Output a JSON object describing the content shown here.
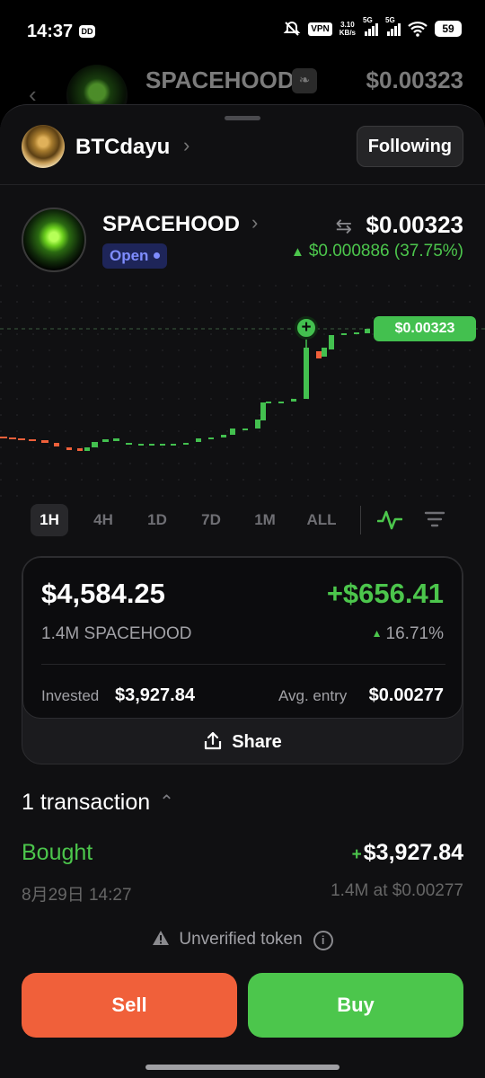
{
  "status_bar": {
    "time": "14:37",
    "app_badge": "DD",
    "vpn": "VPN",
    "speed_value": "3.10",
    "speed_unit": "KB/s",
    "signal1": "5G",
    "signal2": "5G",
    "battery": "59"
  },
  "background_header": {
    "token_name": "SPACEHOOD",
    "price": "$0.00323"
  },
  "creator": {
    "name": "BTCdayu",
    "follow_label": "Following"
  },
  "token": {
    "name": "SPACEHOOD",
    "status": "Open",
    "price": "$0.00323",
    "change": "$0.000886 (37.75%)"
  },
  "chart": {
    "current_price_label": "$0.00323"
  },
  "timeframes": [
    "1H",
    "4H",
    "1D",
    "7D",
    "1M",
    "ALL"
  ],
  "position": {
    "value": "$4,584.25",
    "pnl": "+$656.41",
    "amount": "1.4M SPACEHOOD",
    "pnl_pct": "16.71%",
    "invested_label": "Invested",
    "invested": "$3,927.84",
    "avg_entry_label": "Avg. entry",
    "avg_entry": "$0.00277"
  },
  "share_label": "Share",
  "transactions": {
    "header": "1 transaction",
    "items": [
      {
        "type": "Bought",
        "amount": "$3,927.84",
        "date": "8月29日 14:27",
        "detail": "1.4M at $0.00277"
      }
    ]
  },
  "unverified_label": "Unverified token",
  "actions": {
    "sell": "Sell",
    "buy": "Buy"
  },
  "colors": {
    "green": "#4cc64c",
    "red": "#f0603a",
    "background": "#101012"
  }
}
